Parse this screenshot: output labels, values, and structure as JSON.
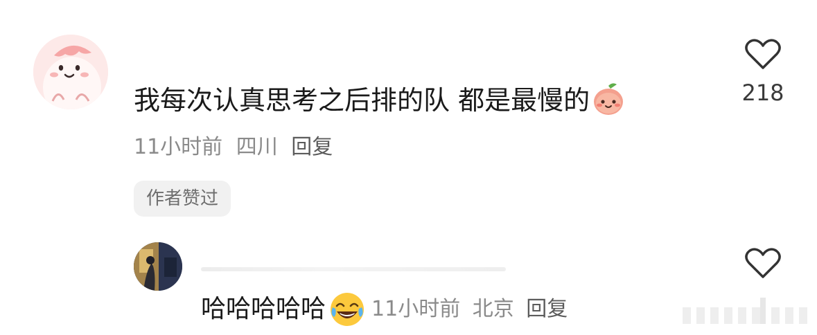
{
  "comments": [
    {
      "avatar": "pink-cartoon-avatar",
      "text": "我每次认真思考之后排的队 都是最慢的",
      "emoji": "peach-smile-emoji",
      "time": "11小时前",
      "location": "四川",
      "reply_label": "回复",
      "badge": "作者赞过",
      "like_icon": "heart-outline-icon",
      "like_count": "218"
    }
  ],
  "reply": {
    "avatar": "dark-photo-avatar",
    "text": "哈哈哈哈哈",
    "emoji": "tears-of-joy-emoji",
    "time": "11小时前",
    "location": "北京",
    "reply_label": "回复",
    "like_icon": "heart-outline-icon"
  },
  "colors": {
    "text_primary": "#1a1a1a",
    "text_secondary": "#8a8a8a",
    "chip_bg": "#f1f1f1",
    "avatar_pink": "#fbe6e6"
  }
}
